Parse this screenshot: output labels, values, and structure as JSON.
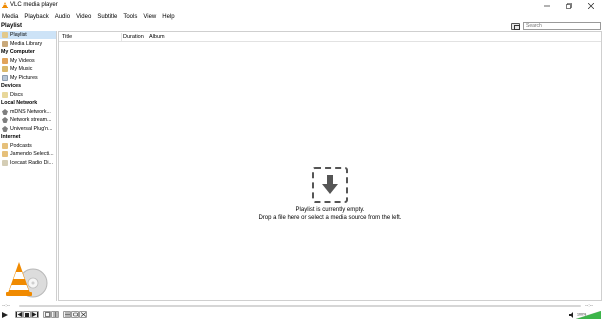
{
  "window": {
    "title": "VLC media player"
  },
  "menu": [
    "Media",
    "Playback",
    "Audio",
    "Video",
    "Subtitle",
    "Tools",
    "View",
    "Help"
  ],
  "search": {
    "placeholder": "Search"
  },
  "sidebar": {
    "header": "Playlist",
    "items": [
      {
        "label": "Playlist",
        "icon": "playlist-icon",
        "selected": true
      },
      {
        "label": "Media Library",
        "icon": "media-library-icon"
      }
    ],
    "my_computer": {
      "label": "My Computer",
      "items": [
        {
          "label": "My Videos",
          "icon": "videos-icon"
        },
        {
          "label": "My Music",
          "icon": "music-icon"
        },
        {
          "label": "My Pictures",
          "icon": "pictures-icon"
        }
      ]
    },
    "devices": {
      "label": "Devices",
      "items": [
        {
          "label": "Discs",
          "icon": "disc-icon"
        }
      ]
    },
    "local_network": {
      "label": "Local Network",
      "items": [
        {
          "label": "mDNS Network...",
          "icon": "network-icon"
        },
        {
          "label": "Network stream...",
          "icon": "network-icon"
        },
        {
          "label": "Universal Plug'n...",
          "icon": "network-icon"
        }
      ]
    },
    "internet": {
      "label": "Internet",
      "items": [
        {
          "label": "Podcasts",
          "icon": "podcast-icon"
        },
        {
          "label": "Jamendo Selecti...",
          "icon": "jamendo-icon"
        },
        {
          "label": "Icecast Radio Di...",
          "icon": "radio-icon"
        }
      ]
    }
  },
  "playlist": {
    "columns": [
      "Title",
      "Duration",
      "Album"
    ],
    "empty_title": "Playlist is currently empty.",
    "empty_hint": "Drop a file here or select a media source from the left."
  },
  "player": {
    "time_elapsed": "--:--",
    "time_total": "--:--",
    "volume_label": "100%"
  },
  "colors": {
    "selection": "#cde3f7",
    "accent_orange": "#f08a00",
    "volume_green": "#3cb54a"
  }
}
